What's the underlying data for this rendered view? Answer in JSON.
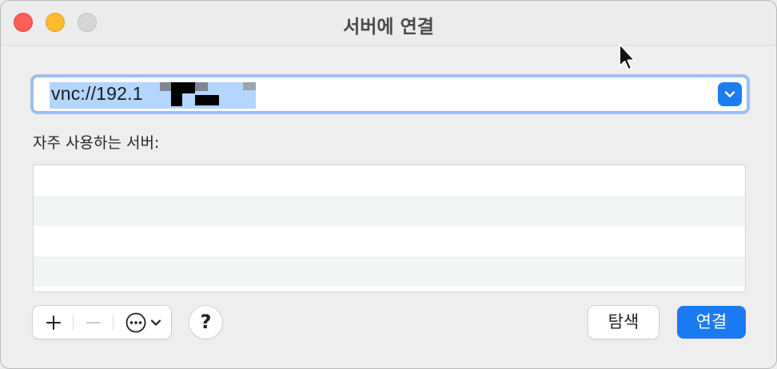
{
  "window": {
    "title": "서버에 연결"
  },
  "address": {
    "value": "vnc://192.1"
  },
  "favorites": {
    "label": "자주 사용하는 서버:",
    "items": []
  },
  "toolbar": {
    "add_icon": "plus-icon",
    "remove_icon": "minus-icon",
    "more_icon": "ellipsis-circle-icon",
    "help_label": "?"
  },
  "buttons": {
    "browse": "탐색",
    "connect": "연결"
  },
  "colors": {
    "accent": "#1a7bf2",
    "selection": "#b3d5ff"
  }
}
